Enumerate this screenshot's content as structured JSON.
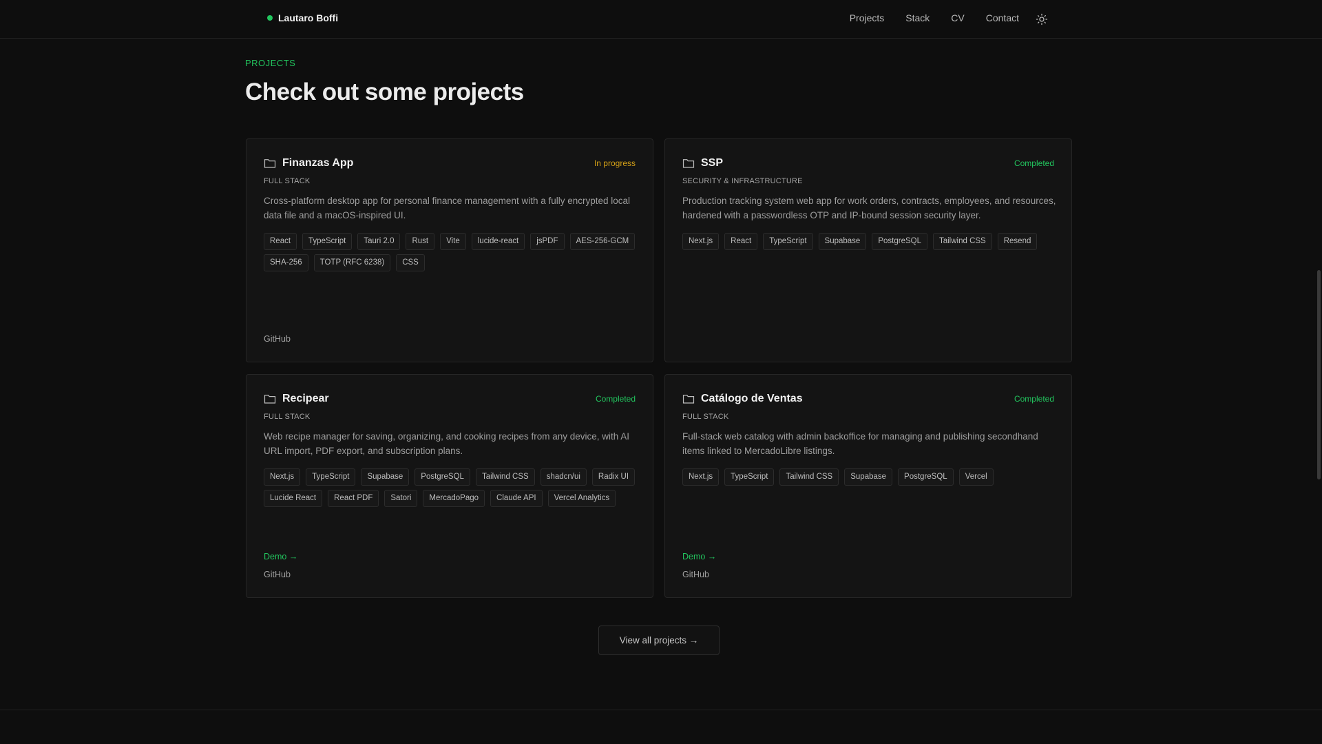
{
  "header": {
    "brand": "Lautaro Boffi",
    "nav": [
      "Projects",
      "Stack",
      "CV",
      "Contact"
    ],
    "theme_icon": "sun-icon"
  },
  "section": {
    "label": "PROJECTS",
    "title": "Check out some projects"
  },
  "projects": [
    {
      "title": "Finanzas App",
      "status": "In progress",
      "category": "FULL STACK",
      "description": "Cross-platform desktop app for personal finance management with a fully encrypted local data file and a macOS-inspired UI.",
      "tags": [
        "React",
        "TypeScript",
        "Tauri 2.0",
        "Rust",
        "Vite",
        "lucide-react",
        "jsPDF",
        "AES-256-GCM",
        "SHA-256",
        "TOTP (RFC 6238)",
        "CSS"
      ],
      "demo": "",
      "github": "GitHub"
    },
    {
      "title": "SSP",
      "status": "Completed",
      "category": "SECURITY & INFRASTRUCTURE",
      "description": "Production tracking system web app for work orders, contracts, employees, and resources, hardened with a passwordless OTP and IP-bound session security layer.",
      "tags": [
        "Next.js",
        "React",
        "TypeScript",
        "Supabase",
        "PostgreSQL",
        "Tailwind CSS",
        "Resend"
      ],
      "demo": "",
      "github": ""
    },
    {
      "title": "Recipear",
      "status": "Completed",
      "category": "FULL STACK",
      "description": "Web recipe manager for saving, organizing, and cooking recipes from any device, with AI URL import, PDF export, and subscription plans.",
      "tags": [
        "Next.js",
        "TypeScript",
        "Supabase",
        "PostgreSQL",
        "Tailwind CSS",
        "shadcn/ui",
        "Radix UI",
        "Lucide React",
        "React PDF",
        "Satori",
        "MercadoPago",
        "Claude API",
        "Vercel Analytics"
      ],
      "demo": "Demo →",
      "github": "GitHub"
    },
    {
      "title": "Catálogo de Ventas",
      "status": "Completed",
      "category": "FULL STACK",
      "description": "Full-stack web catalog with admin backoffice for managing and publishing secondhand items linked to MercadoLibre listings.",
      "tags": [
        "Next.js",
        "TypeScript",
        "Tailwind CSS",
        "Supabase",
        "PostgreSQL",
        "Vercel"
      ],
      "demo": "Demo →",
      "github": "GitHub"
    }
  ],
  "view_all": "View all projects →",
  "colors": {
    "accent": "#22c55e",
    "in_progress": "#d4a017",
    "background": "#0e0e0e"
  }
}
